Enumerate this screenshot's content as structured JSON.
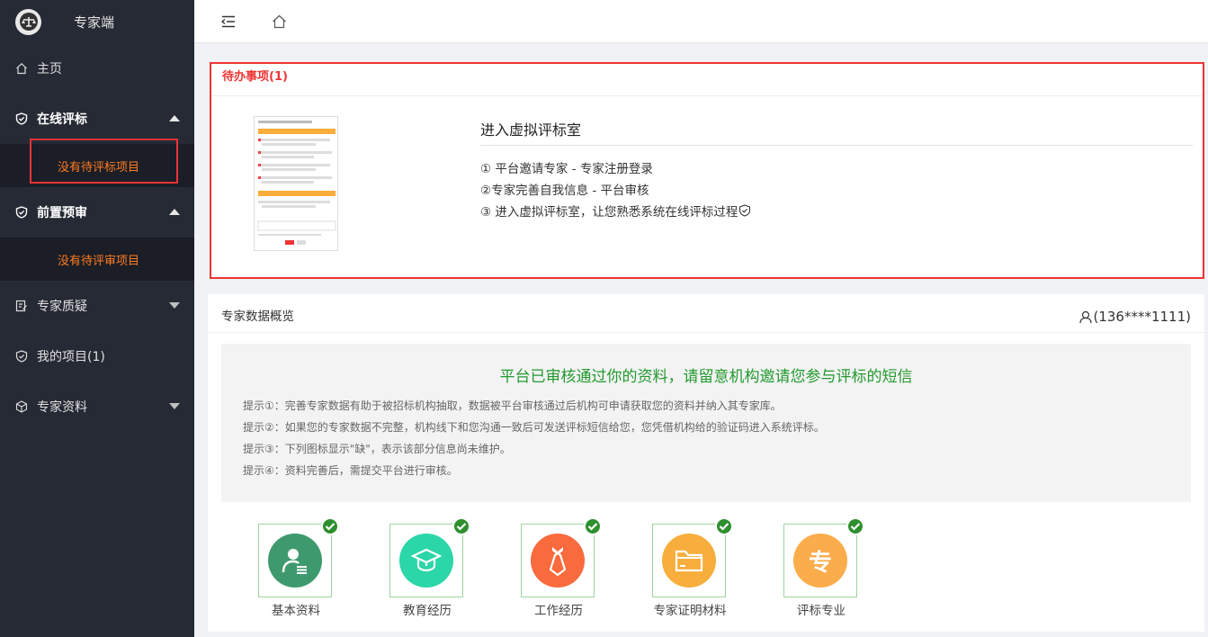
{
  "app": {
    "title": "专家端"
  },
  "sidebar": {
    "items": [
      {
        "label": "主页"
      },
      {
        "label": "在线评标",
        "sub": "没有待评标项目"
      },
      {
        "label": "前置预审",
        "sub": "没有待评审项目"
      },
      {
        "label": "专家质疑"
      },
      {
        "label": "我的项目(1)"
      },
      {
        "label": "专家资料"
      }
    ]
  },
  "todo": {
    "title": "待办事项(1)",
    "virtual_room_title": "进入虚拟评标室",
    "steps": [
      "① 平台邀请专家 - 专家注册登录",
      "②专家完善自我信息 - 平台审核",
      "③ 进入虚拟评标室，让您熟悉系统在线评标过程"
    ]
  },
  "overview": {
    "title": "专家数据概览",
    "user": "(136****1111)",
    "headline": "平台已审核通过你的资料，请留意机构邀请您参与评标的短信",
    "tips": [
      "提示①：完善专家数据有助于被招标机构抽取，数据被平台审核通过后机构可申请获取您的资料并纳入其专家库。",
      "提示②：如果您的专家数据不完整，机构线下和您沟通一致后可发送评标短信给您，您凭借机构给的验证码进入系统评标。",
      "提示③：下列图标显示\"缺\"，表示该部分信息尚未维护。",
      "提示④：资料完善后，需提交平台进行审核。"
    ],
    "cards": [
      {
        "label": "基本资料",
        "color": "#3e9a6e",
        "icon": "person-doc-icon"
      },
      {
        "label": "教育经历",
        "color": "#2bd6a8",
        "icon": "graduation-cap-icon"
      },
      {
        "label": "工作经历",
        "color": "#f96a3d",
        "icon": "tie-icon"
      },
      {
        "label": "专家证明材料",
        "color": "#f7ae3d",
        "icon": "folder-icon"
      },
      {
        "label": "评标专业",
        "color": "#fbad4b",
        "icon": "specialty-icon",
        "glyph": "专"
      }
    ]
  },
  "colors": {
    "accent_red": "#e33",
    "sidebar_bg": "#262a35",
    "submenu_text": "#ff7a21",
    "success_green": "#239a2f"
  }
}
